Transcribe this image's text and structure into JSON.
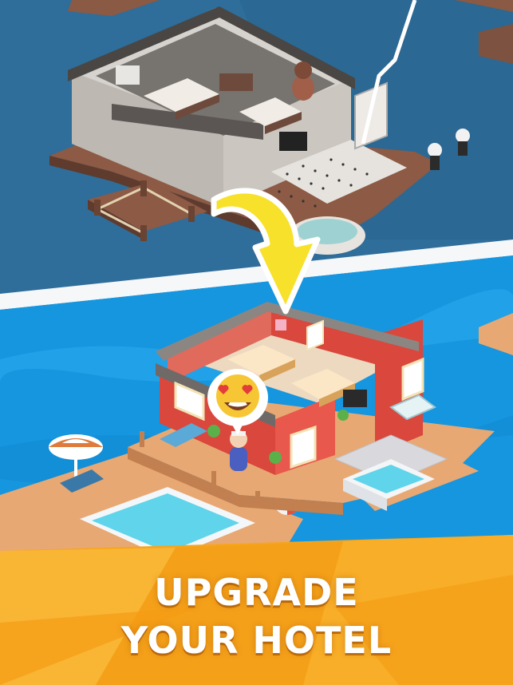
{
  "caption": {
    "line1": "UPGRADE",
    "line2": "YOUR HOTEL"
  },
  "colors": {
    "old_water": "#2f6d9a",
    "new_water": "#1596df",
    "banner": "#f7a51b",
    "arrow": "#f7e12a",
    "hotel_wall": "#d9473d",
    "dock_wood": "#e8a873"
  },
  "icons": {
    "emotion": "heart-eyes-emoji-icon",
    "transition": "curved-arrow-icon"
  }
}
